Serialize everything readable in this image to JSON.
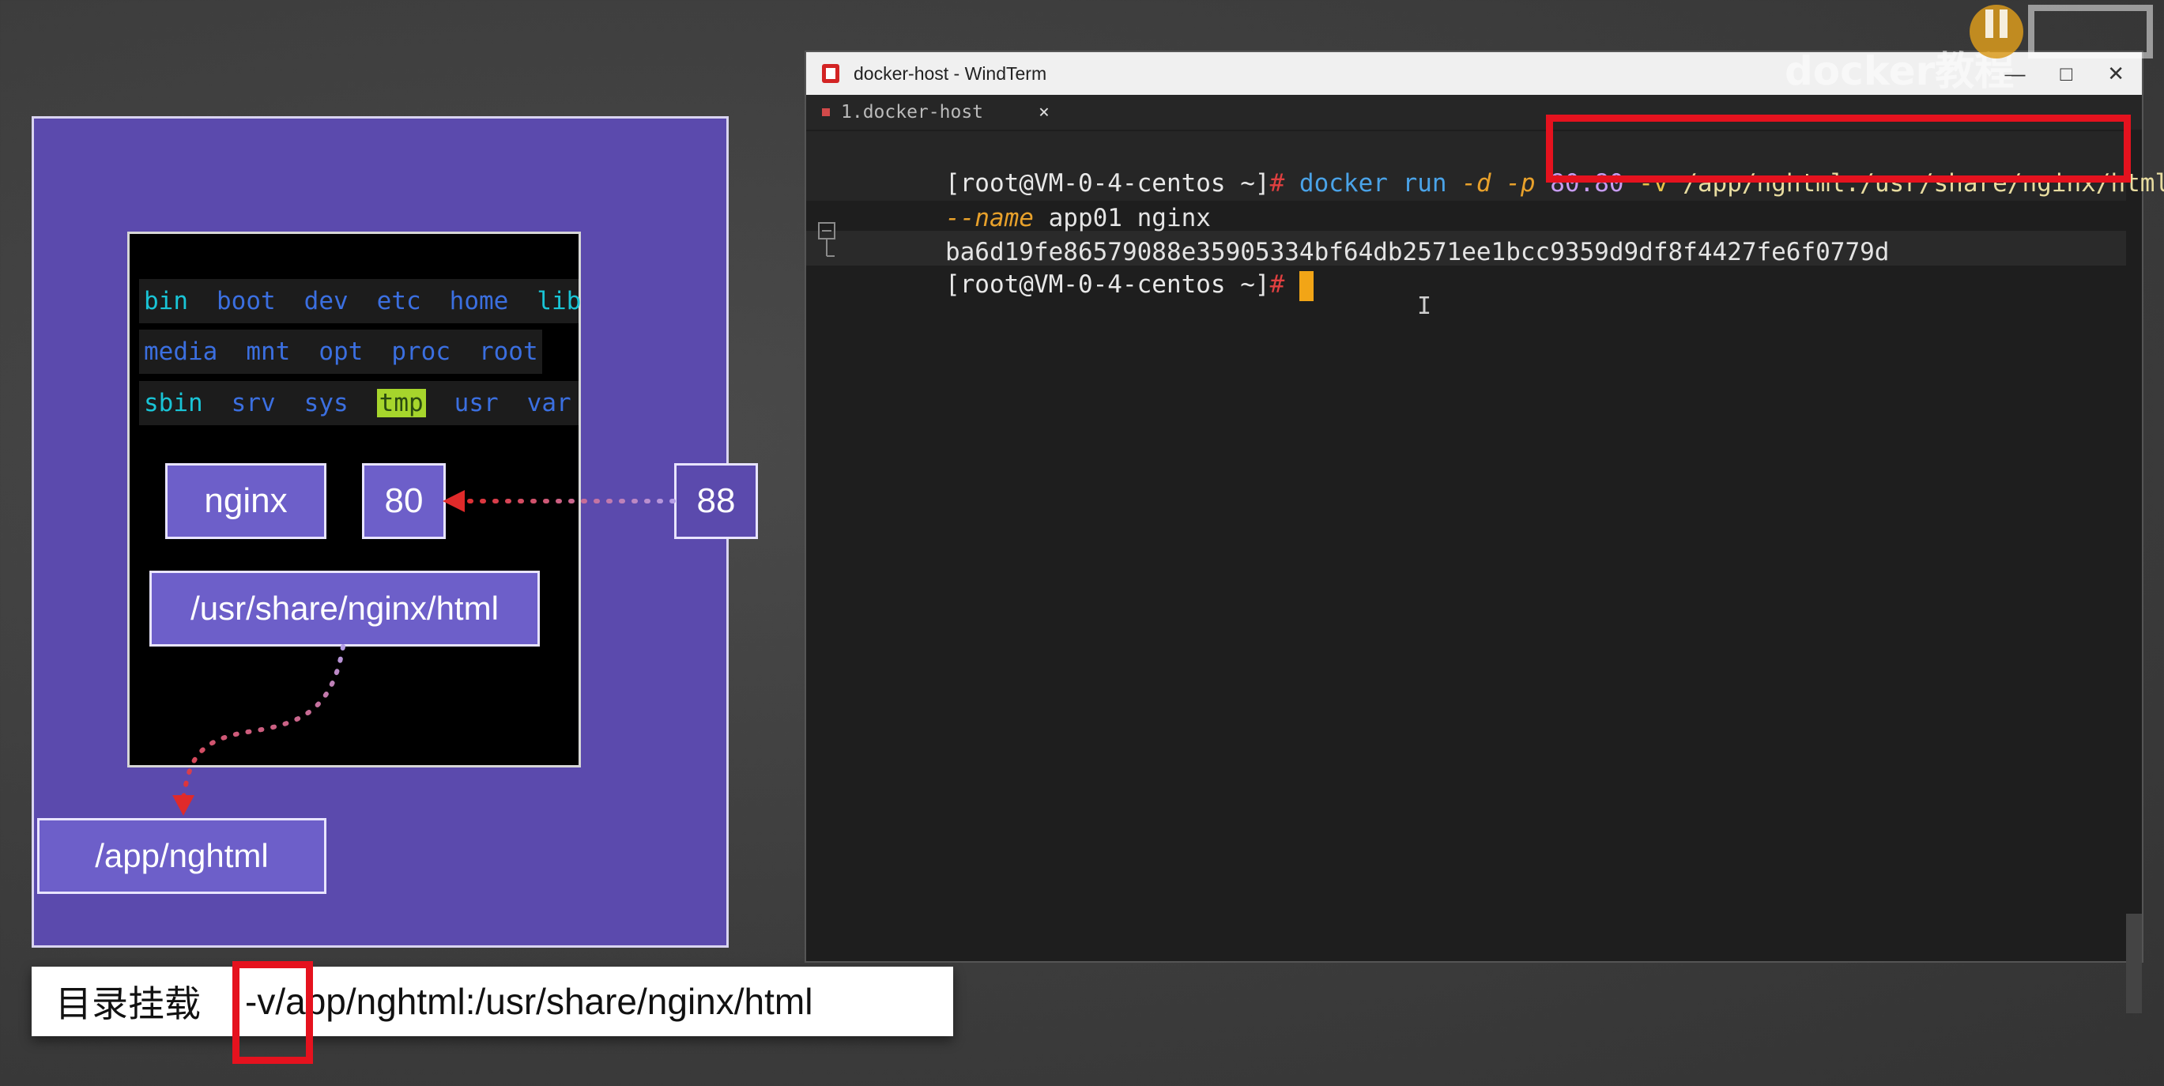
{
  "diagram": {
    "fs_rows": [
      [
        {
          "t": "bin",
          "c": "cyan"
        },
        {
          "t": "boot",
          "c": "blue"
        },
        {
          "t": "dev",
          "c": "blue"
        },
        {
          "t": "etc",
          "c": "blue"
        },
        {
          "t": "home",
          "c": "blue"
        },
        {
          "t": "lib",
          "c": "cyan"
        }
      ],
      [
        {
          "t": "media",
          "c": "blue"
        },
        {
          "t": "mnt",
          "c": "blue"
        },
        {
          "t": "opt",
          "c": "blue"
        },
        {
          "t": "proc",
          "c": "blue"
        },
        {
          "t": "root",
          "c": "blue"
        }
      ],
      [
        {
          "t": "sbin",
          "c": "cyan"
        },
        {
          "t": "srv",
          "c": "blue"
        },
        {
          "t": "sys",
          "c": "blue"
        },
        {
          "t": "tmp",
          "c": "highlight"
        },
        {
          "t": "usr",
          "c": "blue"
        },
        {
          "t": "var",
          "c": "blue"
        }
      ]
    ],
    "container_app": "nginx",
    "container_port": "80",
    "host_port": "88",
    "container_path": "/usr/share/nginx/html",
    "host_path": "/app/nghtml"
  },
  "caption": {
    "label": "目录挂载",
    "flag": "-v",
    "mapping": "/app/nghtml:/usr/share/nginx/html"
  },
  "window": {
    "title": "docker-host - WindTerm",
    "tab_label": "1.docker-host",
    "tab_close": "×",
    "controls": [
      "—",
      "□",
      "✕"
    ],
    "terminal": {
      "line1": {
        "prompt": "[root@VM-0-4-centos ~]",
        "hash": "#",
        "cmd": " docker run ",
        "d": "-d",
        "sp1": " ",
        "p": "-p",
        "ports": " 80:80 ",
        "v": "-v",
        "vpath": " /app/nghtml:/usr/share/nginx/html"
      },
      "line2": {
        "name_flag": "--name",
        "rest": " app01 nginx"
      },
      "line3": "ba6d19fe86579088e35905334bf64db2571ee1bcc9359d9df8f4427fe6f0779d",
      "line4": {
        "prompt": "[root@VM-0-4-centos ~]",
        "hash": "#",
        "space": " "
      }
    }
  },
  "watermark": "docker教程",
  "colors": {
    "accent_red": "#e5121e",
    "host_purple": "#5b4aad",
    "box_purple": "#6d5fc9",
    "cursor": "#f2a516"
  }
}
